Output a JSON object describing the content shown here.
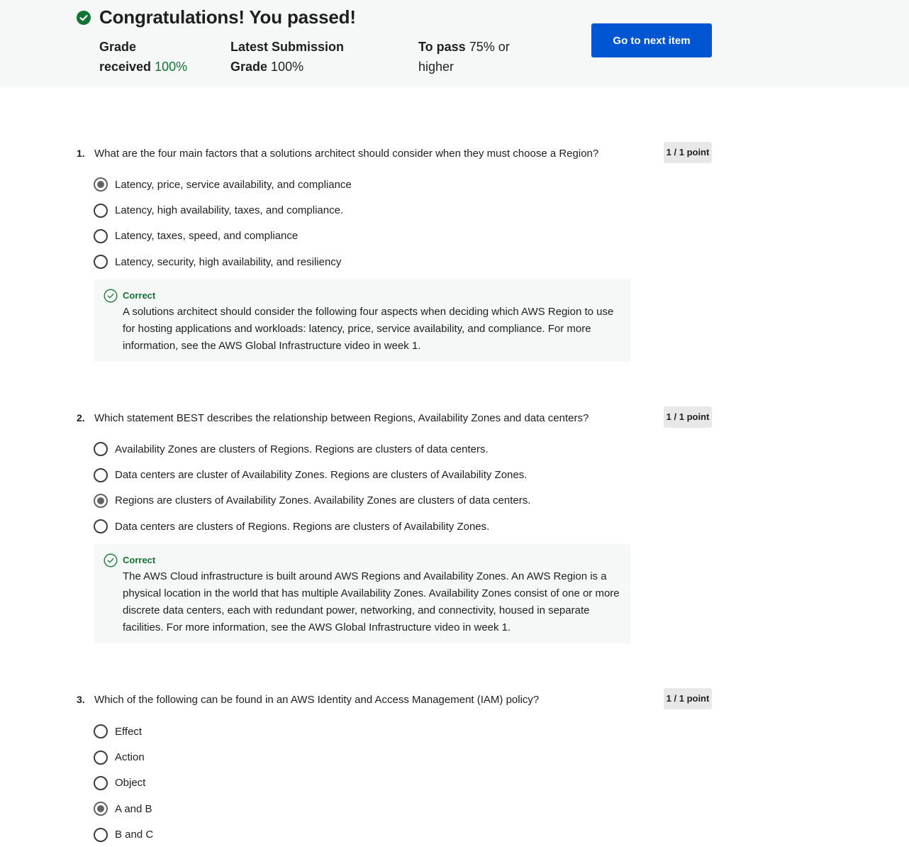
{
  "header": {
    "title": "Congratulations! You passed!",
    "grade_label": "Grade",
    "grade_label2": "received",
    "grade_value": "100%",
    "latest_label": "Latest Submission",
    "latest_label2": "Grade",
    "latest_value": "100%",
    "pass_label": "To pass",
    "pass_value": "75% or",
    "pass_value2": "higher",
    "next_button": "Go to next item"
  },
  "colors": {
    "accent": "#0056d2",
    "success": "#137333",
    "banner_bg": "#f5f8f7"
  },
  "questions": [
    {
      "number": "1.",
      "text": "What are the four main factors that a solutions architect should consider when they must choose a Region?",
      "score": "1 / 1 point",
      "options": [
        {
          "label": "Latency, price, service availability, and compliance",
          "selected": true
        },
        {
          "label": "Latency, high availability, taxes, and compliance.",
          "selected": false
        },
        {
          "label": "Latency, taxes, speed, and compliance",
          "selected": false
        },
        {
          "label": "Latency, security, high availability, and resiliency",
          "selected": false
        }
      ],
      "feedback": {
        "title": "Correct",
        "text": "A solutions architect should consider the following four aspects when deciding which AWS Region to use for hosting applications and workloads: latency, price, service availability, and compliance. For more information, see the AWS Global Infrastructure video in week 1."
      }
    },
    {
      "number": "2.",
      "text": "Which statement BEST describes the relationship between Regions, Availability Zones and data centers?",
      "score": "1 / 1 point",
      "options": [
        {
          "label": "Availability Zones are clusters of Regions. Regions are clusters of data centers.",
          "selected": false
        },
        {
          "label": "Data centers are cluster of Availability Zones. Regions are clusters of Availability Zones.",
          "selected": false
        },
        {
          "label": "Regions are clusters of Availability Zones. Availability Zones are clusters of data centers.",
          "selected": true
        },
        {
          "label": "Data centers are clusters of Regions. Regions are clusters of Availability Zones.",
          "selected": false
        }
      ],
      "feedback": {
        "title": "Correct",
        "text": "The AWS Cloud infrastructure is built around AWS Regions and Availability Zones. An AWS Region is a physical location in the world that has multiple Availability Zones. Availability Zones consist of one or more discrete data centers, each with redundant power, networking, and connectivity, housed in separate facilities. For more information, see the AWS Global Infrastructure video in week 1."
      }
    },
    {
      "number": "3.",
      "text": "Which of the following can be found in an AWS Identity and Access Management (IAM) policy?",
      "score": "1 / 1 point",
      "options": [
        {
          "label": "Effect",
          "selected": false
        },
        {
          "label": "Action",
          "selected": false
        },
        {
          "label": "Object",
          "selected": false
        },
        {
          "label": "A and B",
          "selected": true
        },
        {
          "label": "B and C",
          "selected": false
        }
      ]
    }
  ]
}
